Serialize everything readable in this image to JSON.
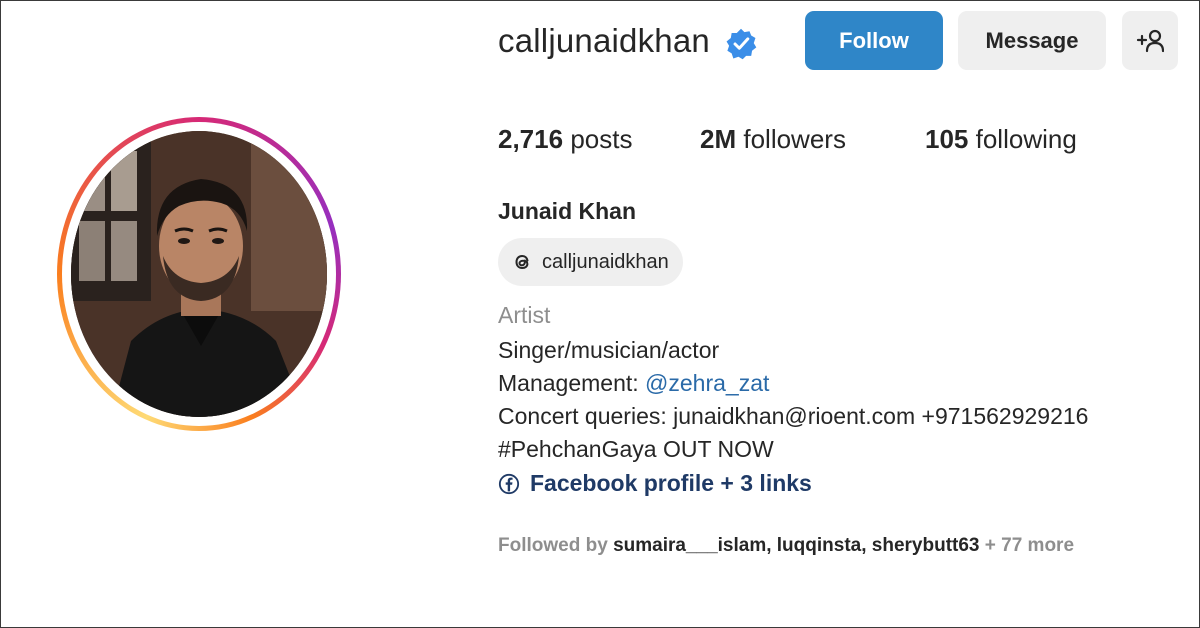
{
  "profile": {
    "username": "calljunaidkhan",
    "full_name": "Junaid Khan",
    "threads_handle": "calljunaidkhan",
    "category": "Artist"
  },
  "actions": {
    "follow_label": "Follow",
    "message_label": "Message",
    "add_user_glyph": "+👤"
  },
  "stats": {
    "posts_count": "2,716",
    "posts_label": "posts",
    "followers_count": "2M",
    "followers_label": "followers",
    "following_count": "105",
    "following_label": "following"
  },
  "bio": {
    "line1": "Singer/musician/actor",
    "line2_prefix": "Management: ",
    "line2_mention": "@zehra_zat",
    "line3": "Concert queries: junaidkhan@rioent.com +971562929216",
    "line4": "#PehchanGaya OUT NOW",
    "links_label": "Facebook profile + 3 links"
  },
  "followed_by": {
    "prefix": "Followed by ",
    "names": "sumaira___islam, luqqinsta, sherybutt63",
    "suffix": " + 77 more"
  },
  "icons": {
    "verified": "verified-badge-icon",
    "threads": "threads-icon",
    "facebook": "facebook-icon",
    "add_user": "add-user-icon"
  },
  "colors": {
    "follow_button": "#2f86c8",
    "secondary_button": "#efefef",
    "mention": "#2a6aa8",
    "link": "#1f3a66",
    "muted": "#8e8e8e",
    "verified": "#3b8ee8"
  }
}
